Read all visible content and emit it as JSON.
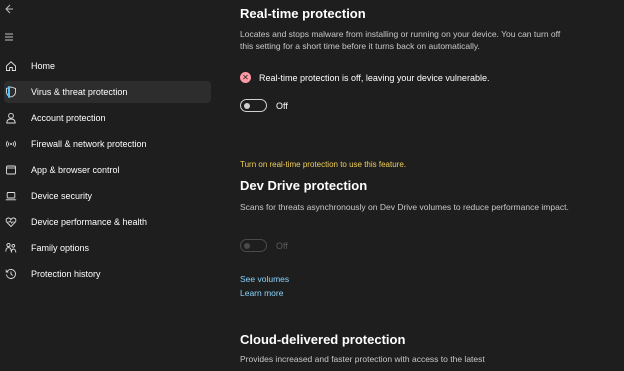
{
  "sidebar": {
    "back_icon": "back-arrow-icon",
    "menu_icon": "hamburger-menu-icon",
    "items": [
      {
        "label": "Home",
        "icon": "home-icon"
      },
      {
        "label": "Virus & threat protection",
        "icon": "shield-icon"
      },
      {
        "label": "Account protection",
        "icon": "person-icon"
      },
      {
        "label": "Firewall & network protection",
        "icon": "wifi-signal-icon"
      },
      {
        "label": "App & browser control",
        "icon": "app-window-icon"
      },
      {
        "label": "Device security",
        "icon": "laptop-icon"
      },
      {
        "label": "Device performance & health",
        "icon": "heart-icon"
      },
      {
        "label": "Family options",
        "icon": "family-icon"
      },
      {
        "label": "Protection history",
        "icon": "history-icon"
      }
    ],
    "selected_index": 1
  },
  "realtime": {
    "title": "Real-time protection",
    "description": "Locates and stops malware from installing or running on your device. You can turn off this setting for a short time before it turns back on automatically.",
    "warning": "Real-time protection is off, leaving your device vulnerable.",
    "toggle_label": "Off",
    "toggle_on": false
  },
  "devdrive": {
    "note": "Turn on real-time protection to use this feature.",
    "title": "Dev Drive protection",
    "description": "Scans for threats asynchronously on Dev Drive volumes to reduce performance impact.",
    "toggle_label": "Off",
    "toggle_on": false,
    "toggle_disabled": true,
    "link_volumes": "See volumes",
    "link_learn": "Learn more"
  },
  "cloud": {
    "title": "Cloud-delivered protection",
    "description": "Provides increased and faster protection with access to the latest"
  },
  "colors": {
    "background": "#1e1e1e",
    "accent": "#4cc2ff",
    "warning_note": "#f2cf58",
    "error": "#ff99a4",
    "link": "#8ad4ff"
  }
}
